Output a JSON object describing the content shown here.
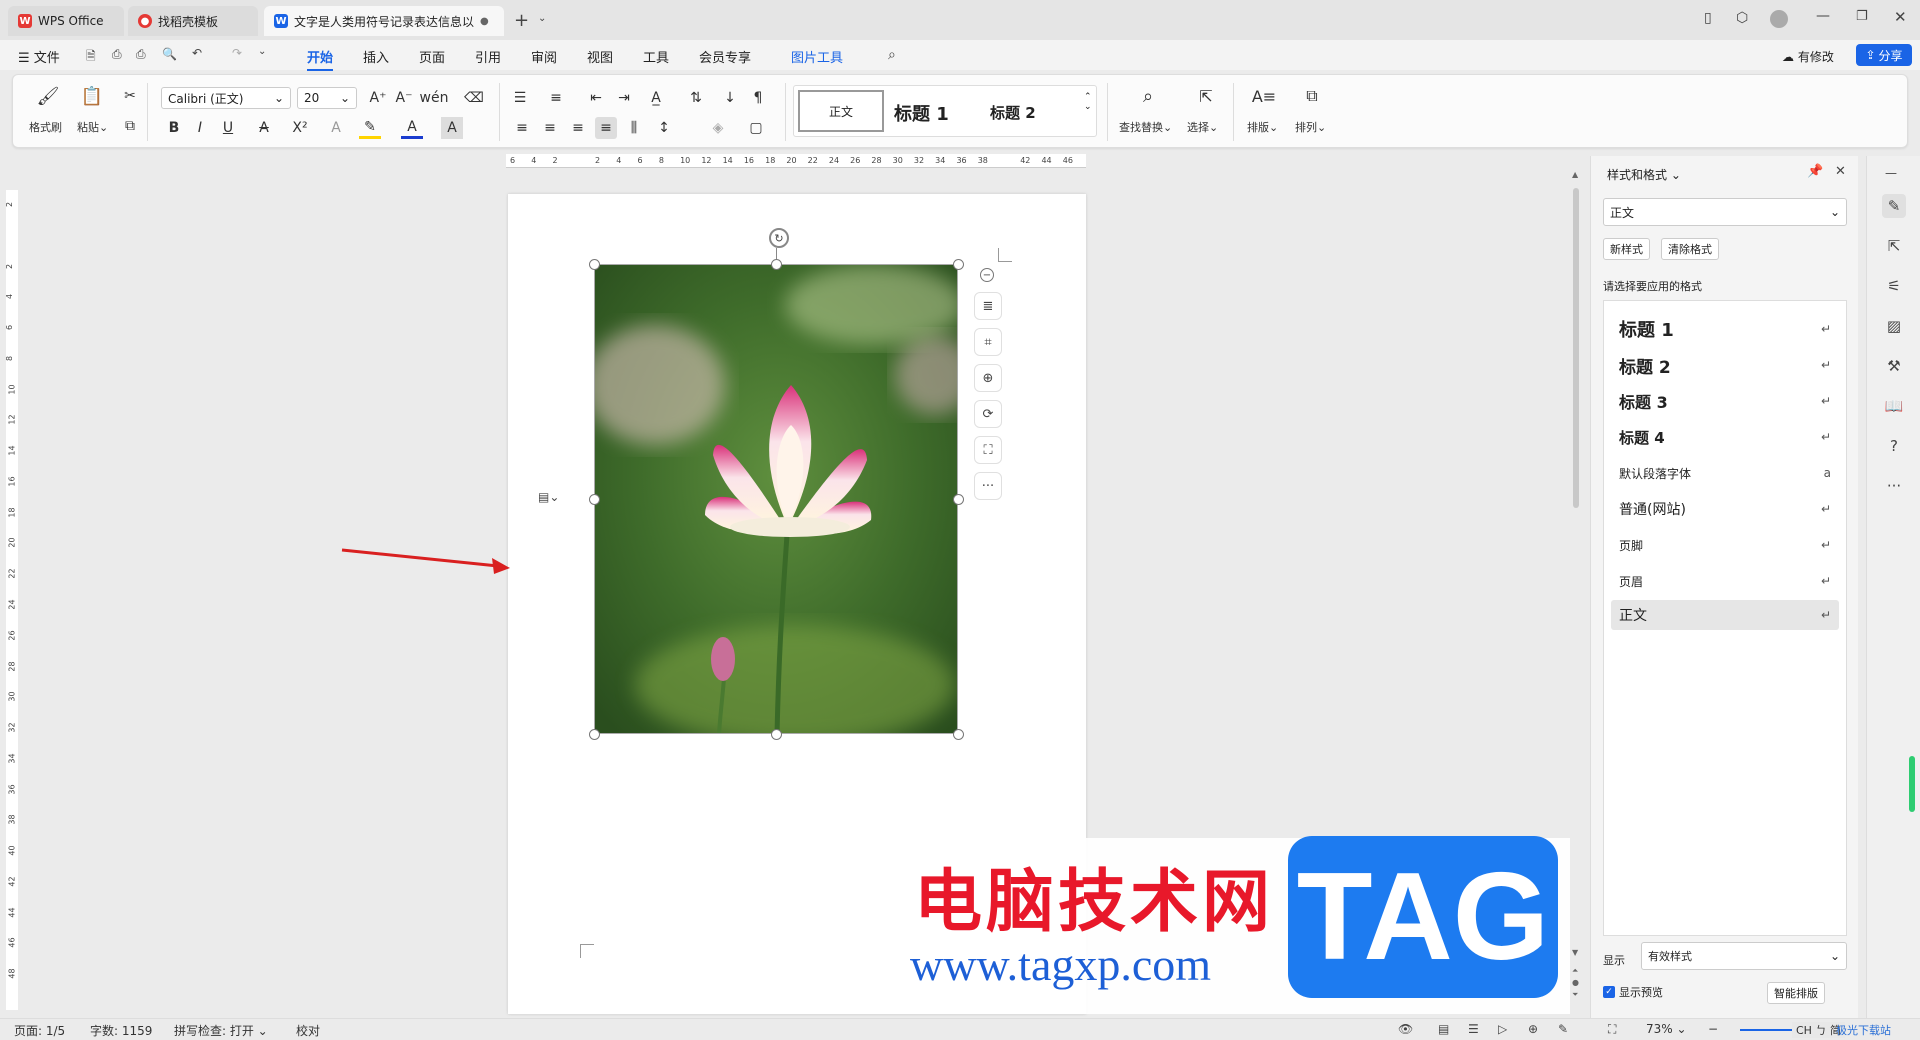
{
  "tabs": [
    {
      "label": "WPS Office",
      "icon": "wps-logo-icon"
    },
    {
      "label": "找稻壳模板",
      "icon": "docer-logo-icon"
    },
    {
      "label": "文字是人类用符号记录表达信息以",
      "icon": "writer-logo-icon",
      "active": true
    }
  ],
  "menu": {
    "file": "文件",
    "items": [
      "开始",
      "插入",
      "页面",
      "引用",
      "审阅",
      "视图",
      "工具",
      "会员专享",
      "图片工具"
    ],
    "active": "开始",
    "has_changes": "有修改",
    "share": "分享"
  },
  "ribbon": {
    "format_painter": "格式刷",
    "paste": "粘贴",
    "font_name": "Calibri (正文)",
    "font_size": "20",
    "styles": [
      "正文",
      "标题 1",
      "标题 2"
    ],
    "find_replace": "查找替换",
    "select": "选择",
    "layout": "排版",
    "arrange": "排列"
  },
  "ruler": {
    "h_ticks": [
      "6",
      "4",
      "2",
      "",
      "2",
      "4",
      "6",
      "8",
      "10",
      "12",
      "14",
      "16",
      "18",
      "20",
      "22",
      "24",
      "26",
      "28",
      "30",
      "32",
      "34",
      "36",
      "38",
      "",
      "42",
      "44",
      "46"
    ],
    "v_ticks": [
      "2",
      "",
      "2",
      "4",
      "6",
      "8",
      "10",
      "12",
      "14",
      "16",
      "18",
      "20",
      "22",
      "24",
      "26",
      "28",
      "30",
      "32",
      "34",
      "36",
      "38",
      "40",
      "42",
      "44",
      "46",
      "48"
    ]
  },
  "side_panel": {
    "title": "样式和格式",
    "current_style": "正文",
    "new_style": "新样式",
    "clear_format": "清除格式",
    "prompt": "请选择要应用的格式",
    "styles": [
      {
        "label": "标题 1",
        "marker": "↵"
      },
      {
        "label": "标题 2",
        "marker": "↵"
      },
      {
        "label": "标题 3",
        "marker": "↵"
      },
      {
        "label": "标题 4",
        "marker": "↵"
      },
      {
        "label": "默认段落字体",
        "marker": "a"
      },
      {
        "label": "普通(网站)",
        "marker": "↵"
      },
      {
        "label": "页脚",
        "marker": "↵"
      },
      {
        "label": "页眉",
        "marker": "↵"
      },
      {
        "label": "正文",
        "marker": "↵",
        "selected": true
      }
    ],
    "show_label": "显示",
    "show_value": "有效样式",
    "preview_label": "显示预览",
    "smart_layout": "智能排版"
  },
  "status": {
    "page": "页面: 1/5",
    "words": "字数: 1159",
    "spell": "拼写检查: 打开",
    "proof": "校对",
    "zoom": "73%"
  },
  "watermark": {
    "cn": "电脑技术网",
    "url": "www.tagxp.com",
    "tag": "TAG",
    "corner": "极光下载站"
  },
  "ime": "CH ㄅ 简",
  "colors": {
    "accent": "#1a64e6",
    "wps_red": "#e53935",
    "watermark_red": "#e8182a",
    "tag_blue": "#1d7bf0"
  }
}
